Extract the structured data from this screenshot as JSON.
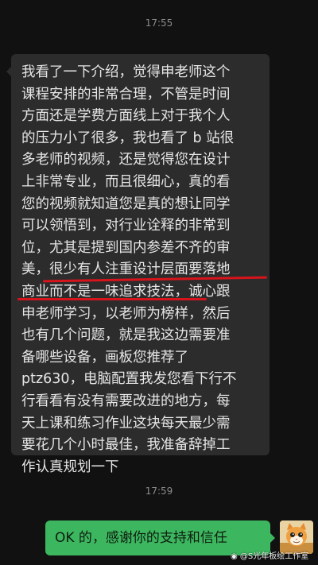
{
  "timestamps": [
    "17:55",
    "17:59"
  ],
  "incoming_message": {
    "lines": [
      "我看了一下介绍，觉得申老师这个",
      "课程安排的非常合理，不管是时间",
      "方面还是学费方面线上对于我个人",
      "的压力小了很多，我也看了 b 站很",
      "多老师的视频，还是觉得您在设计",
      "上非常专业，而且很细心，真的看",
      "您的视频就知道您是真的想让同学",
      "可以领悟到，对行业诠释的非常到",
      "位，尤其是提到国内参差不齐的审",
      "美，很少有人注重设计层面要落地",
      "商业而不是一味追求技法，诚心跟",
      "申老师学习，以老师为榜样，然后",
      "也有几个问题，就是我这边需要准",
      "备哪些设备，画板您推荐了",
      "ptz630，电脑配置我发您看下行不",
      "行看看有没有需要改进的地方，每",
      "天上课和练习作业这块每天最少需",
      "要花几个小时最佳，我准备辞掉工",
      "作认真规划一下"
    ]
  },
  "outgoing_message": {
    "text": "OK 的，感谢你的支持和信任"
  },
  "watermark": "@S光年板绘工作室",
  "colors": {
    "background": "#111111",
    "incoming_bubble": "#2c2c2c",
    "outgoing_bubble": "#3db75f",
    "annotation_underline": "#d7141b"
  },
  "icons": {
    "avatar": "cat-avatar-icon",
    "watermark": "weibo-icon"
  }
}
